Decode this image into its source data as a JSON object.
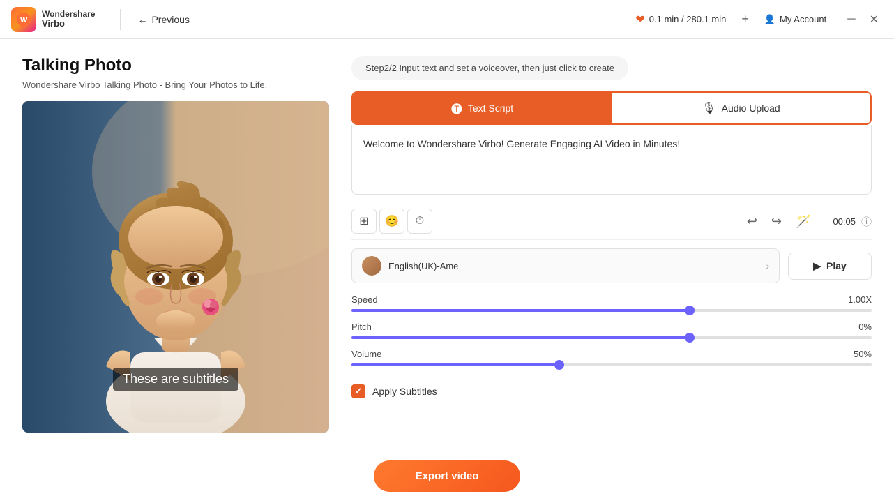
{
  "app": {
    "brand": "Wondershare",
    "product": "Virbo",
    "logo_letter": "W"
  },
  "titlebar": {
    "previous_label": "Previous",
    "credits_label": "0.1 min / 280.1 min",
    "add_label": "+",
    "account_label": "My Account",
    "minimize_icon": "─",
    "close_icon": "✕"
  },
  "page": {
    "title": "Talking Photo",
    "subtitle": "Wondershare Virbo Talking Photo - Bring Your Photos to Life.",
    "step_hint": "Step2/2 Input text and set a voiceover, then just click to create"
  },
  "tabs": {
    "text_script_label": "Text Script",
    "audio_upload_label": "Audio Upload"
  },
  "editor": {
    "text_content": "Welcome to Wondershare Virbo! Generate Engaging AI Video in Minutes!",
    "timer": "00:05"
  },
  "subtitle_overlay": "These are subtitles",
  "voice": {
    "name": "English(UK)-Ame",
    "play_label": "▶ Play"
  },
  "sliders": {
    "speed_label": "Speed",
    "speed_value": "1.00X",
    "speed_percent": 65,
    "pitch_label": "Pitch",
    "pitch_value": "0%",
    "pitch_percent": 65,
    "volume_label": "Volume",
    "volume_value": "50%",
    "volume_percent": 40
  },
  "apply_subtitles": {
    "label": "Apply Subtitles"
  },
  "export": {
    "label": "Export video"
  }
}
